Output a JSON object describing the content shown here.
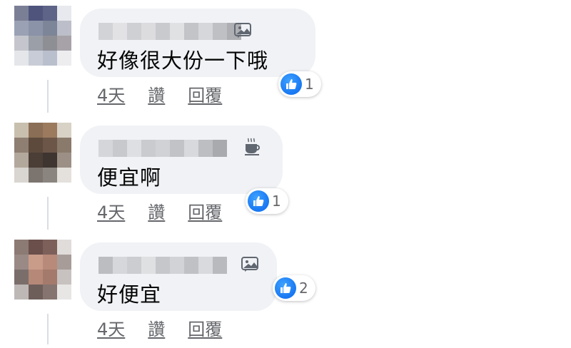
{
  "colors": {
    "bubble": "#f0f2f5",
    "like_blue": "#1877f2",
    "meta_text": "#65676b",
    "thread_line": "#dadde1"
  },
  "comments": [
    {
      "text": "好像很大份一下哦",
      "author_badge_icon": "photo-icon",
      "time": "4天",
      "like_label": "讚",
      "reply_label": "回覆",
      "reaction_icon": "like-icon",
      "reaction_count": "1"
    },
    {
      "text": "便宜啊",
      "author_badge_icon": "coffee-cup-icon",
      "time": "4天",
      "like_label": "讚",
      "reply_label": "回覆",
      "reaction_icon": "like-icon",
      "reaction_count": "1"
    },
    {
      "text": "好便宜",
      "author_badge_icon": "photo-icon",
      "time": "4天",
      "like_label": "讚",
      "reply_label": "回覆",
      "reaction_icon": "like-icon",
      "reaction_count": "2"
    }
  ]
}
